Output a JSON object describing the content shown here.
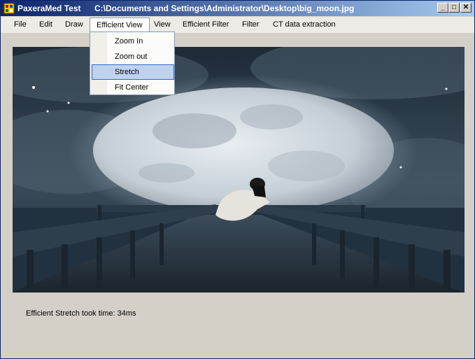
{
  "window": {
    "app_title": "PaxeraMed Test",
    "file_path": "C:\\Documents and Settings\\Administrator\\Desktop\\big_moon.jpg",
    "caption_buttons": {
      "minimize": "_",
      "maximize": "□",
      "close": "✕"
    }
  },
  "menubar": {
    "items": [
      "File",
      "Edit",
      "Draw",
      "Efficient View",
      "View",
      "Efficient Filter",
      "Filter",
      "CT data extraction"
    ],
    "open_menu": "Efficient View"
  },
  "dropdown": {
    "items": [
      "Zoom In",
      "Zoom out",
      "Stretch",
      "Fit Center"
    ],
    "highlighted": "Stretch"
  },
  "image": {
    "name": "big_moon.jpg"
  },
  "status": {
    "text": "Efficient Stretch took time: 34ms"
  }
}
